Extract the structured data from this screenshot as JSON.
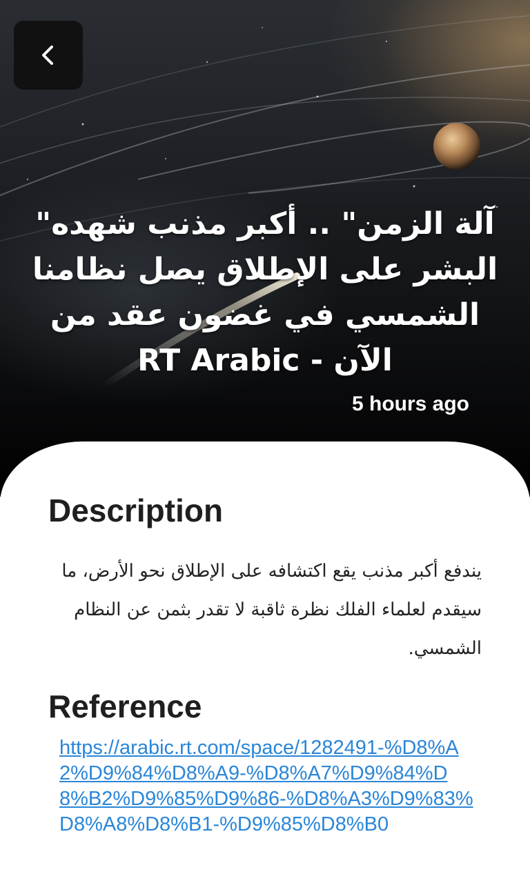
{
  "header": {
    "back_icon": "chevron-left-icon"
  },
  "article": {
    "title": "آلة الزمن\" .. أكبر مذنب شهده\" البشر على الإطلاق يصل نظامنا الشمسي في غضون عقد من الآن - RT Arabic",
    "time_ago": "5 hours ago",
    "description_label": "Description",
    "description": "يندفع أكبر مذنب يقع اكتشافه على الإطلاق نحو الأرض، ما سيقدم لعلماء الفلك نظرة ثاقبة لا تقدر بثمن عن النظام الشمسي.",
    "reference_label": "Reference",
    "reference_url": "https://arabic.rt.com/space/1282491-%D8%A2%D9%84%D8%A9-%D8%A7%D9%84%D8%B2%D9%85%D9%86-%D8%A3%D9%83%D8%A8%D8%B1-%D9%85%D8%B0"
  },
  "colors": {
    "link": "#2a86d8",
    "heading": "#1f1f1f",
    "back_button_bg": "#111111"
  }
}
